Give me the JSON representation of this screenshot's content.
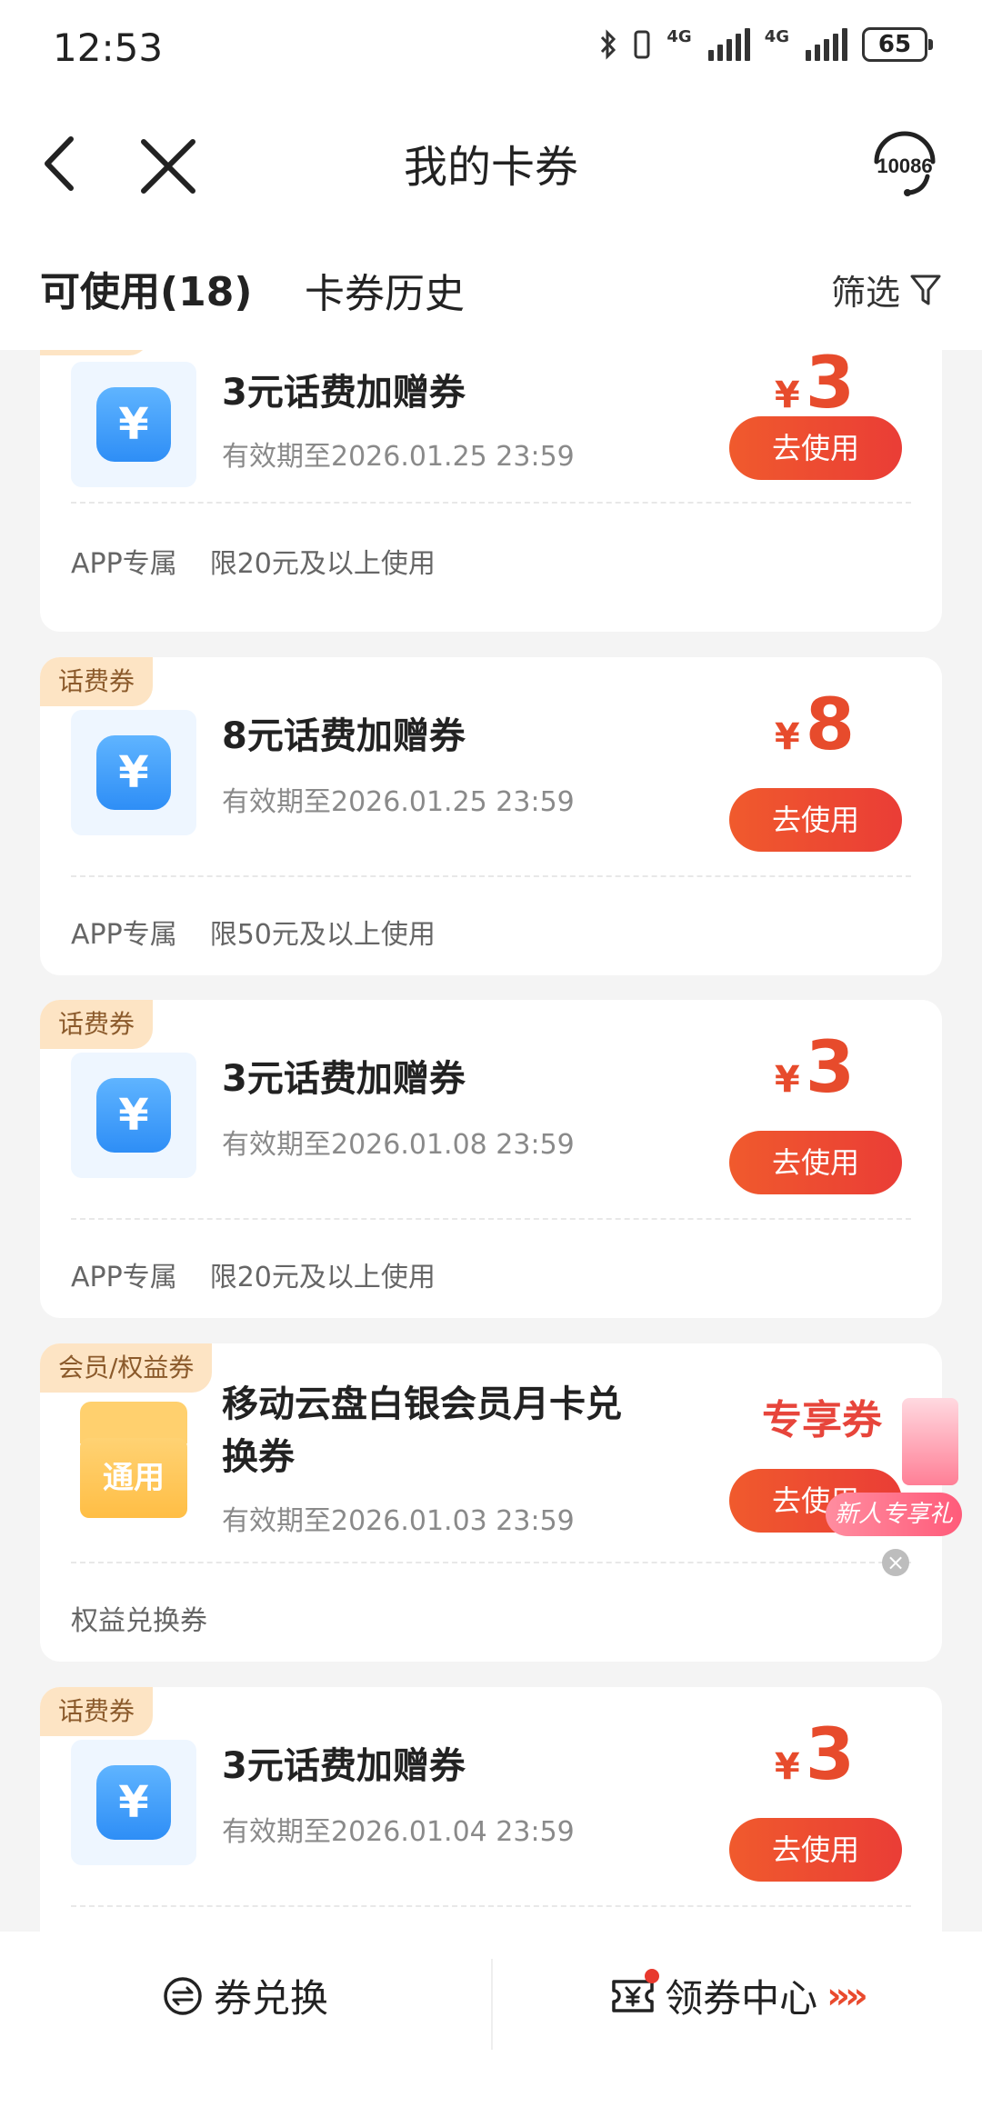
{
  "status": {
    "time": "12:53",
    "net1": "4G",
    "net2": "4G",
    "battery": "65"
  },
  "nav": {
    "title": "我的卡券",
    "service": "10086"
  },
  "tabs": {
    "available": "可使用(18)",
    "history": "卡券历史",
    "filter": "筛选"
  },
  "cards": [
    {
      "badge": "",
      "title": "3元话费加赠券",
      "expiry": "有效期至2026.01.25 23:59",
      "symbol": "¥",
      "amount": "3",
      "button": "去使用",
      "foot1": "APP专属",
      "foot2": "限20元及以上使用"
    },
    {
      "badge": "话费券",
      "title": "8元话费加赠券",
      "expiry": "有效期至2026.01.25 23:59",
      "symbol": "¥",
      "amount": "8",
      "button": "去使用",
      "foot1": "APP专属",
      "foot2": "限50元及以上使用"
    },
    {
      "badge": "话费券",
      "title": "3元话费加赠券",
      "expiry": "有效期至2026.01.08 23:59",
      "symbol": "¥",
      "amount": "3",
      "button": "去使用",
      "foot1": "APP专属",
      "foot2": "限20元及以上使用"
    },
    {
      "badge": "会员/权益券",
      "title1": "移动云盘白银会员月卡兑",
      "title2": "换券",
      "general": "通用",
      "expiry": "有效期至2026.01.03 23:59",
      "exclusive": "专享券",
      "button": "去使用",
      "foot1": "权益兑换券"
    },
    {
      "badge": "话费券",
      "title": "3元话费加赠券",
      "expiry": "有效期至2026.01.04 23:59",
      "symbol": "¥",
      "amount": "3",
      "button": "去使用"
    }
  ],
  "promo": {
    "tag": "新人专享礼",
    "close": "×"
  },
  "bottom": {
    "exchange": "券兑换",
    "center": "领券中心",
    "chevrons": "»»"
  },
  "icons": {
    "yen": "¥"
  },
  "colors": {
    "accent": "#E84A2E",
    "badge_bg": "#FDE4C4"
  }
}
